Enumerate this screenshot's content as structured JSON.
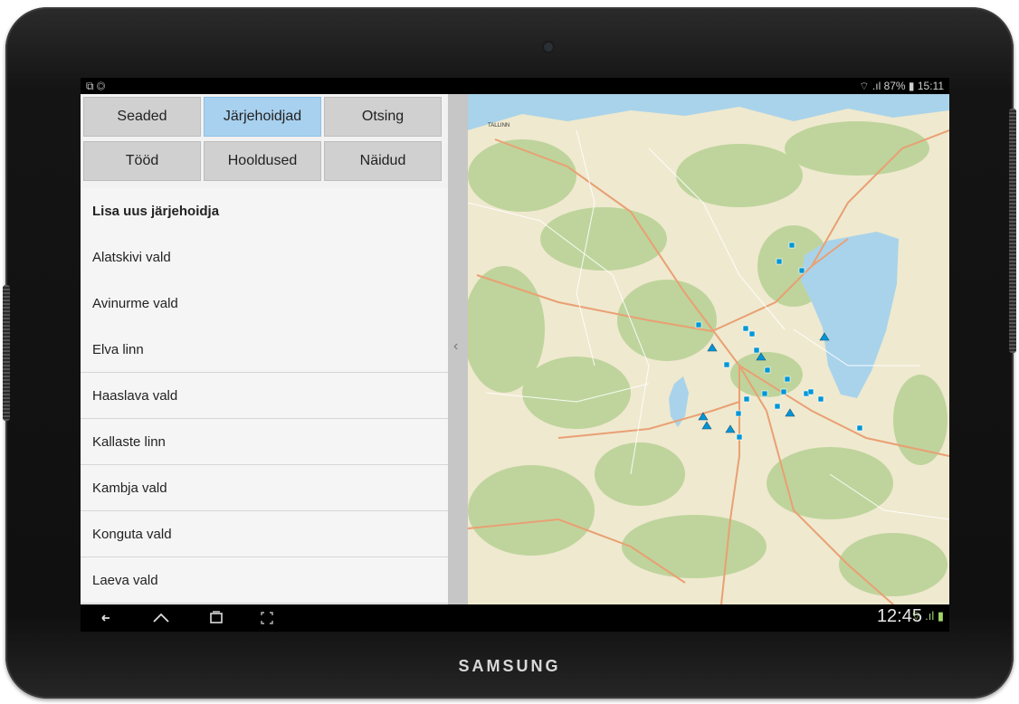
{
  "device": {
    "brand": "SAMSUNG"
  },
  "status_bar": {
    "left_icons": "⧉ ◎",
    "right": "⌔ .ıl 87% ▮ 15:11"
  },
  "buttons": {
    "row1": [
      "Seaded",
      "Järjehoidjad",
      "Otsing"
    ],
    "row2": [
      "Tööd",
      "Hooldused",
      "Näidud"
    ],
    "active": "Järjehoidjad"
  },
  "list": {
    "add_label": "Lisa uus järjehoidja",
    "items": [
      "Alatskivi vald",
      "Avinurme vald",
      "Elva linn",
      "Haaslava vald",
      "Kallaste linn",
      "Kambja vald",
      "Konguta vald",
      "Laeva vald"
    ]
  },
  "collapse_handle": "‹",
  "map": {
    "labels": {
      "tallinn": "TALLINN"
    },
    "colors": {
      "land": "#efe9cf",
      "forest": "#bcd39a",
      "water": "#a9d3ea",
      "road_major": "#e9a073",
      "road_minor": "#ffffff",
      "marker": "#0096d6"
    }
  },
  "nav_bar": {
    "clock": "12:45",
    "icons": "⌔ .ıl ▮"
  }
}
